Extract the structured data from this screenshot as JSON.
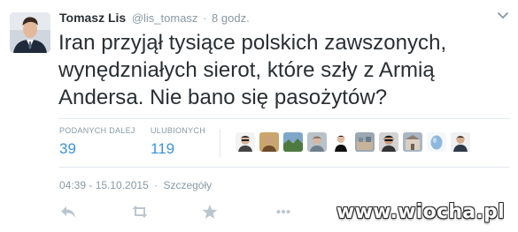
{
  "tweet": {
    "author_name": "Tomasz Lis",
    "author_handle": "@lis_tomasz",
    "separator": "·",
    "time_ago": "8 godz.",
    "text": "Iran przyjął tysiące polskich zawszonych, wynędzniałych sierot, które szły z Armią Andersa. Nie bano się pasożytów?",
    "timestamp": "04:39 - 15.10.2015",
    "timestamp_sep": "·",
    "details_link": "Szczegóły"
  },
  "stats": {
    "retweets_label": "PODANYCH DALEJ",
    "retweets_value": "39",
    "favorites_label": "ULUBIONYCH",
    "favorites_value": "119"
  },
  "actions": {
    "reply_icon": "reply-icon",
    "retweet_icon": "retweet-icon",
    "favorite_icon": "star-icon",
    "more_icon": "more-icon"
  },
  "watermark": "www.wiocha.pl",
  "colors": {
    "text": "#292f33",
    "muted": "#8899a6",
    "accent": "#3b94d9",
    "divider": "#e1e8ed",
    "icon": "#bcc6cf"
  }
}
